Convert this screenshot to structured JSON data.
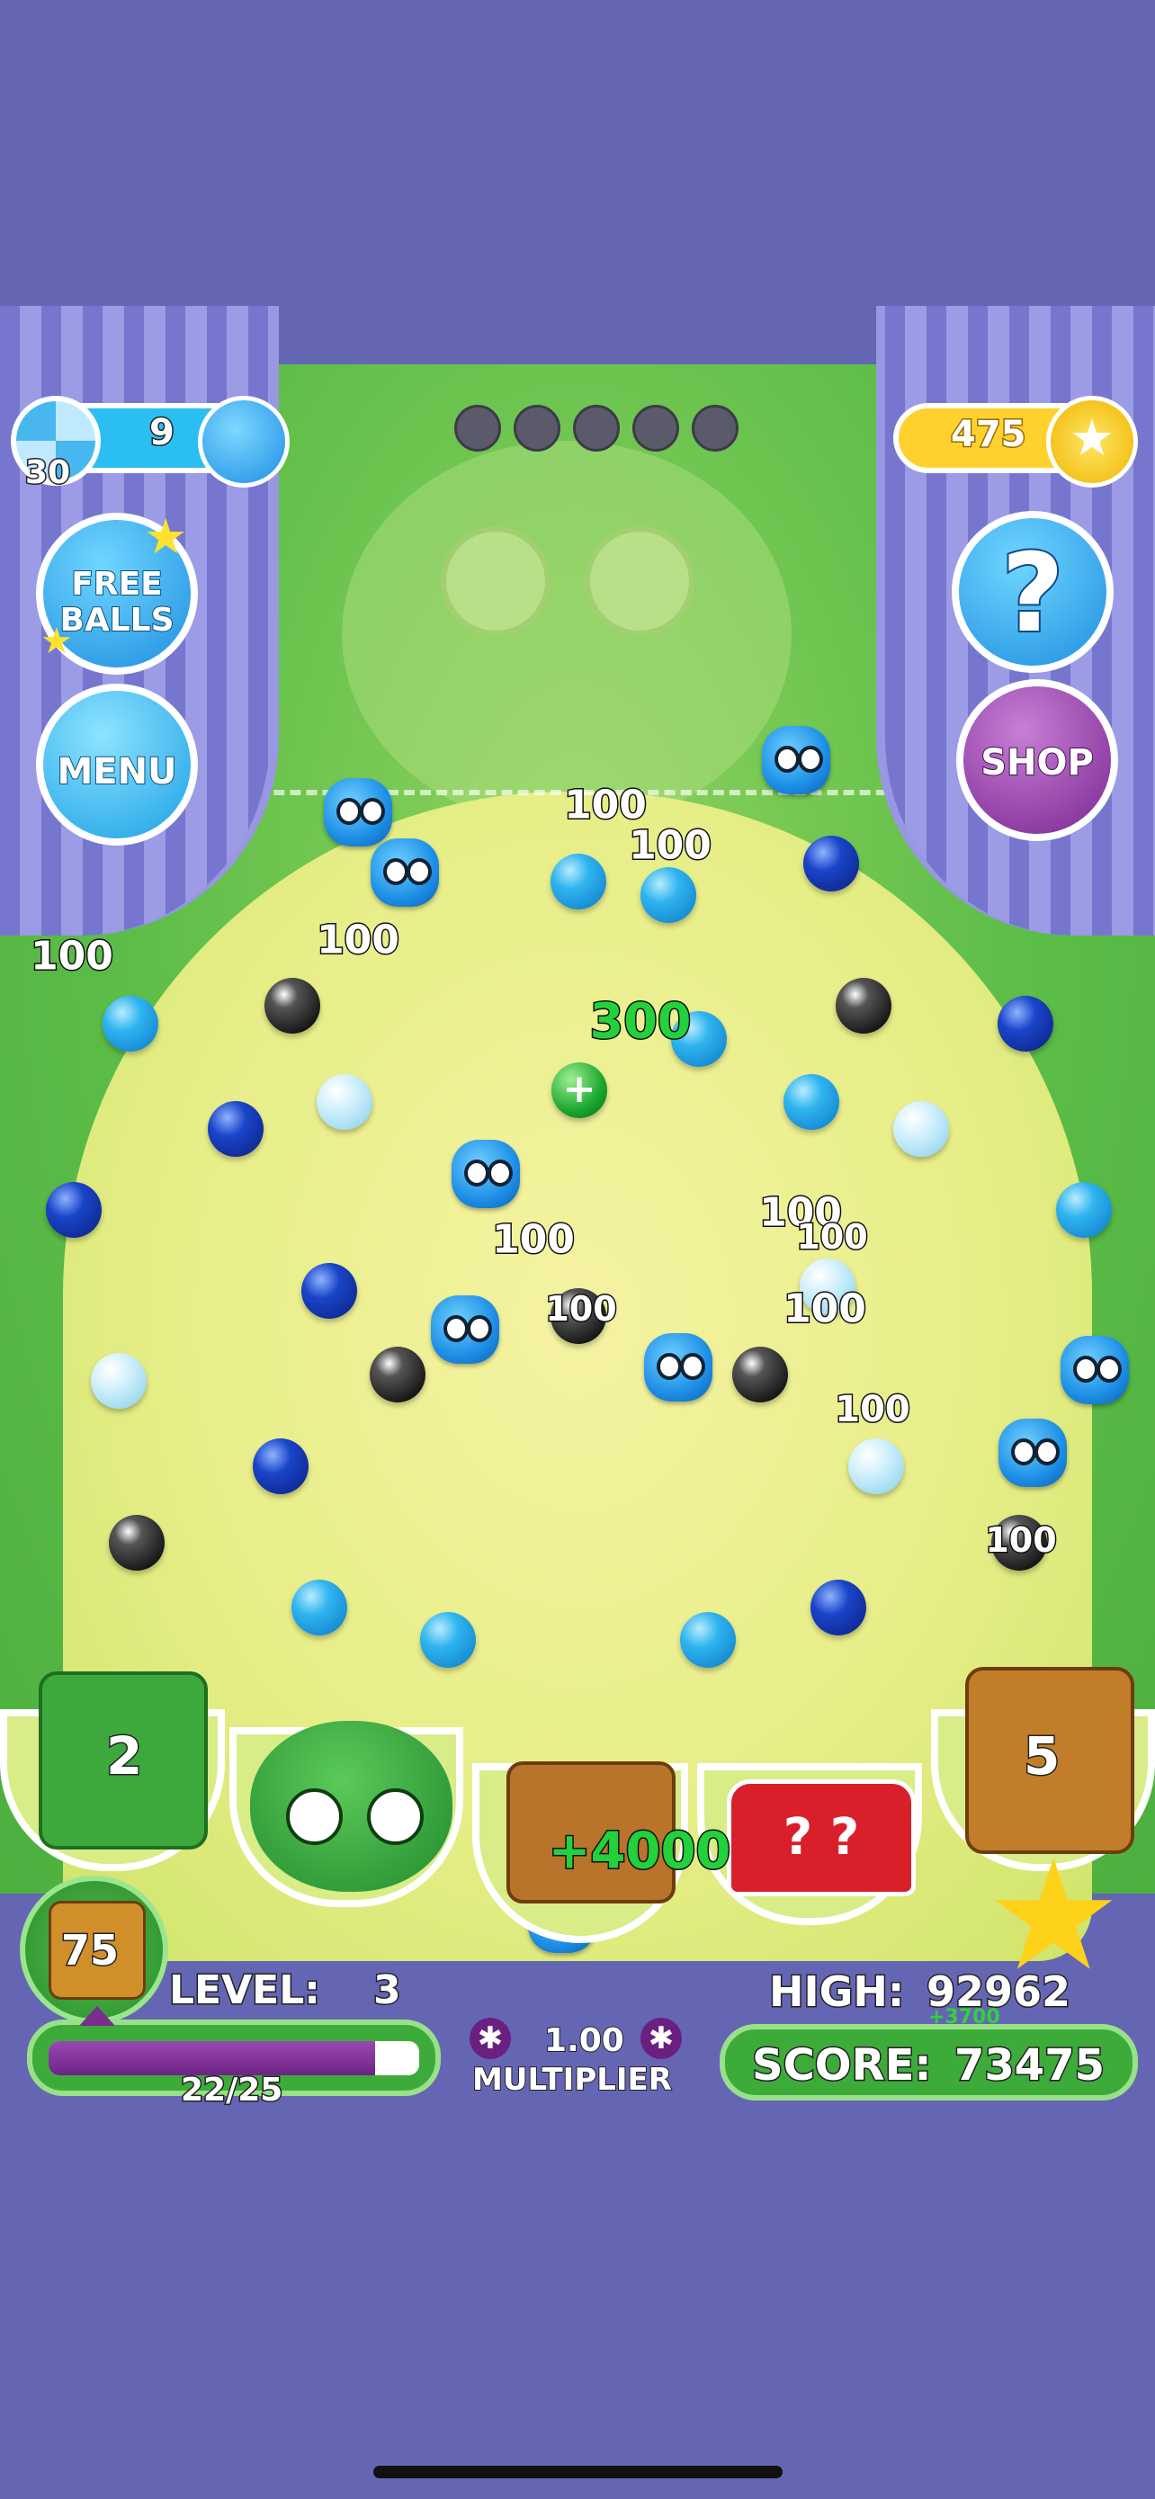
{
  "hud_top": {
    "balls_left": "9",
    "reload_count": "30",
    "coins": "475",
    "free_balls_label": "FREE BALLS",
    "menu_label": "MENU",
    "help_label": "?",
    "shop_label": "SHOP",
    "shot_indicators": [
      "",
      "",
      "",
      "",
      ""
    ]
  },
  "popups": {
    "p1": "100",
    "p2": "100",
    "p3": "100",
    "p4": "100",
    "p5": "300",
    "p6": "100",
    "p7": "100",
    "p8": "100",
    "p9": "100",
    "p10": "100",
    "p11": "100",
    "p12": "100",
    "p13": "+4000"
  },
  "buckets": {
    "green_bucket_count": "2",
    "gold_bucket_count": "5"
  },
  "hud_bottom": {
    "puzzle_pieces": "75",
    "level_label": "LEVEL:",
    "level_value": "3",
    "progress_text": "22/25",
    "progress": 0.88,
    "multiplier_value": "1.00",
    "multiplier_label": "MULTIPLIER",
    "high_label": "HIGH:",
    "high_value": "92962",
    "score_delta": "+3700",
    "score_label": "SCORE:",
    "score_value": "73475"
  },
  "colors": {
    "background": "#6566b3",
    "field_green": "#5cbd48",
    "field_yellow": "#e7ee88",
    "coin_pill": "#ffd12e",
    "shop_purple": "#8a2f9b",
    "progress_purple": "#7b2d8f"
  },
  "icons": {
    "coin": "star-coin-icon",
    "balls": "blue-ball-face-icon",
    "reload": "wheel-icon"
  }
}
